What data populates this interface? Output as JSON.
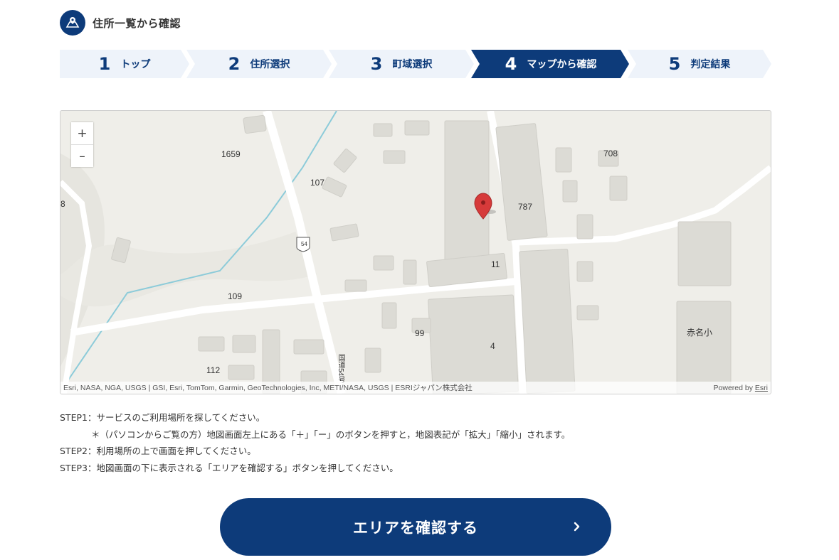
{
  "header": {
    "title": "住所一覧から確認",
    "icon": "map-pin-icon"
  },
  "steps": [
    {
      "num": "1",
      "label": "トップ",
      "active": false
    },
    {
      "num": "2",
      "label": "住所選択",
      "active": false
    },
    {
      "num": "3",
      "label": "町域選択",
      "active": false
    },
    {
      "num": "4",
      "label": "マップから確認",
      "active": true
    },
    {
      "num": "5",
      "label": "判定結果",
      "active": false
    }
  ],
  "map": {
    "zoom_in": "+",
    "zoom_out": "–",
    "labels": {
      "l1659": "1659",
      "l107": "107",
      "l708": "708",
      "l787": "787",
      "l8": "8",
      "l11": "11",
      "l109": "109",
      "l99": "99",
      "l4": "4",
      "l112": "112",
      "akana": "赤名小",
      "route": "54",
      "road_name": "国道54号"
    },
    "attribution": "Esri, NASA, NGA, USGS | GSI, Esri, TomTom, Garmin, GeoTechnologies, Inc, METI/NASA, USGS | ESRIジャパン株式会社",
    "powered_by": "Powered by",
    "esri": "Esri"
  },
  "instructions": {
    "step1": "STEP1：サービスのご利用場所を探してください。",
    "note": "＊（パソコンからご覧の方）地図画面左上にある「＋」「ー」のボタンを押すと，地図表記が「拡大」「縮小」されます。",
    "step2": "STEP2：利用場所の上で画面を押してください。",
    "step3": "STEP3：地図画面の下に表示される「エリアを確認する」ボタンを押してください。"
  },
  "cta": {
    "label": "エリアを確認する"
  },
  "colors": {
    "brand": "#0d3b7a",
    "step_bg": "#eef3fa",
    "map_bg": "#efeee9",
    "pin": "#d63a3a"
  }
}
